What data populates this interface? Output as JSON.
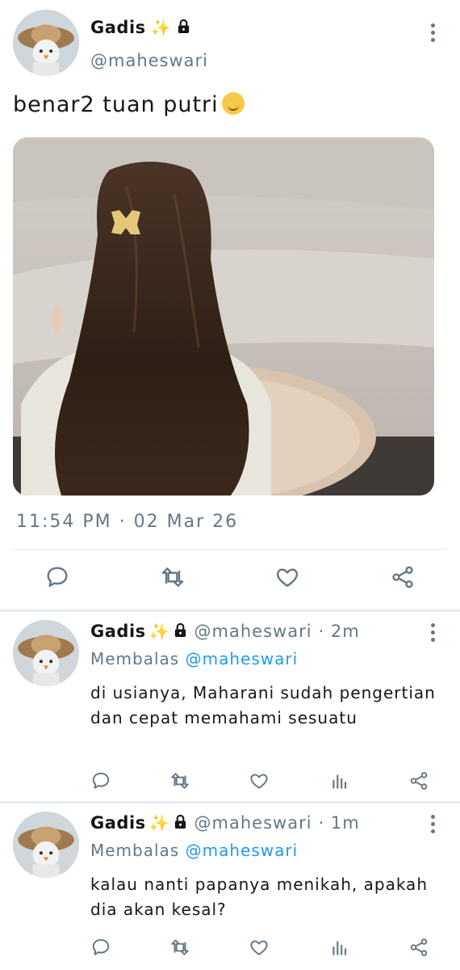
{
  "tweet": {
    "display_name": "Gadis",
    "sparkle": "✨",
    "handle": "@maheswari",
    "text": "benar2 tuan putri",
    "emoji": "relieved-face-emoji",
    "timestamp": "11:54 PM · 02 Mar 26",
    "actions": [
      "reply-icon",
      "retweet-icon",
      "like-icon",
      "share-icon"
    ]
  },
  "replies": [
    {
      "display_name": "Gadis",
      "sparkle": "✨",
      "handle": "@maheswari",
      "time": "· 2m",
      "replying_label": "Membalas",
      "replying_to": "@maheswari",
      "text": "di usianya, Maharani sudah pengertian dan cepat memahami sesuatu"
    },
    {
      "display_name": "Gadis",
      "sparkle": "✨",
      "handle": "@maheswari",
      "time": "· 1m",
      "replying_label": "Membalas",
      "replying_to": "@maheswari",
      "text": "kalau nanti papanya menikah, apakah dia akan kesal?"
    }
  ],
  "colors": {
    "accent": "#1d9bf0",
    "muted": "#657786",
    "divider": "#e1e8ed"
  }
}
